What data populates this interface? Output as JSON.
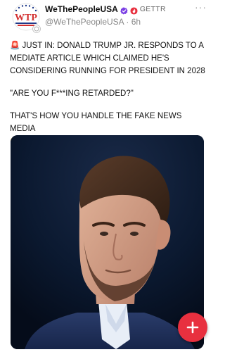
{
  "post": {
    "author_name": "WeThePeopleUSA",
    "platform_label": "GETTR",
    "handle": "@WeThePeopleUSA",
    "separator": "·",
    "time_ago": "6h",
    "more_label": "···",
    "avatar_text": "WTP",
    "line1_emoji": "🚨",
    "line1_text": "JUST IN: DONALD TRUMP JR. RESPONDS TO A MEDIATE ARTICLE WHICH CLAIMED HE'S CONSIDERING RUNNING FOR PRESIDENT IN 2028",
    "quote": "\"ARE YOU F***ING RETARDED?\"",
    "line3_text": "THAT'S HOW YOU HANDLE THE FAKE NEWS MEDIA",
    "emojis": "🤣🦅🇺🇸"
  },
  "colors": {
    "verified_badge": "#7b3fe4",
    "fab": "#e8303f",
    "avatar_red": "#d32f2f",
    "avatar_blue": "#1e3a8a"
  },
  "icons": {
    "verified": "verified-badge-icon",
    "gettr": "gettr-flame-icon",
    "fab": "plus-icon"
  }
}
